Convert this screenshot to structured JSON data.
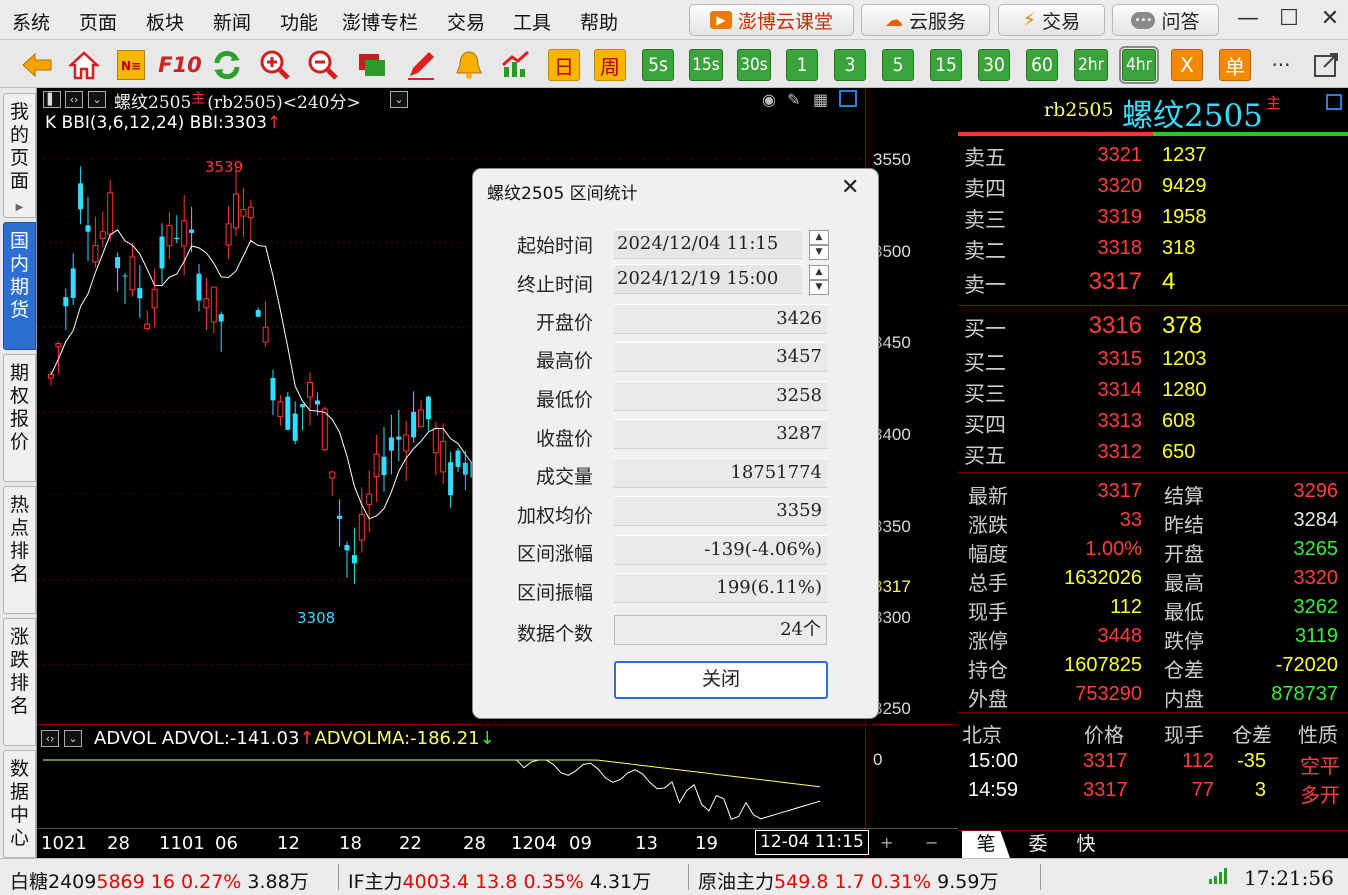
{
  "menu": [
    "系统",
    "页面",
    "板块",
    "新闻",
    "功能",
    "澎博专栏",
    "交易",
    "工具",
    "帮助"
  ],
  "top_buttons": [
    "澎博云课堂",
    "云服务",
    "交易",
    "问答"
  ],
  "toolbar": {
    "icons": [
      "back-arrow-icon",
      "home-icon",
      "news-icon",
      "f10-icon",
      "refresh-icon",
      "zoom-in-icon",
      "zoom-out-icon",
      "layers-icon",
      "pen-icon",
      "bell-icon",
      "trend-icon"
    ],
    "f10": "F10",
    "periods": [
      "日",
      "周",
      "5s",
      "15s",
      "30s",
      "1",
      "3",
      "5",
      "15",
      "30",
      "60",
      "2hr",
      "4hr"
    ],
    "selected_period": "4hr",
    "x_label": "X",
    "order_label": "单",
    "more": "···"
  },
  "sidebar": [
    {
      "label": "我的页面",
      "active": false
    },
    {
      "label": "国内期货",
      "active": true
    },
    {
      "label": "期权报价",
      "active": false
    },
    {
      "label": "热点排名",
      "active": false
    },
    {
      "label": "涨跌排名",
      "active": false
    },
    {
      "label": "数据中心",
      "active": false
    }
  ],
  "chart": {
    "title": "螺纹2505",
    "title_tag": "主",
    "code_period": "(rb2505)<240分>",
    "indicator_line": "K BBI(3,6,12,24) BBI:3303",
    "up_arrow": "↑",
    "high_label": "3539",
    "low_label": "3308",
    "last_price_label": "3317",
    "sub_indicator_name": "ADVOL",
    "sub_indicator_val": "ADVOL:-141.03",
    "sub_indicator_ma": "ADVOLMA:-186.21",
    "sub_arrow_up": "↑",
    "sub_arrow_down": "↓",
    "sub_zero_label": "0",
    "date_axis": [
      "1021",
      "28",
      "1101",
      "06",
      "12",
      "18",
      "22",
      "28",
      "1204",
      "09",
      "13",
      "19"
    ],
    "cursor_time": "12-04 11:15",
    "zoom_plus": "+",
    "zoom_minus": "−",
    "colors": {
      "up": "#ff3333",
      "down": "#33ddff",
      "bbi": "#ffffff",
      "advolma": "#ffff66"
    }
  },
  "chart_data": {
    "type": "candlestick",
    "price_axis": [
      "3550",
      "3500",
      "3450",
      "3400",
      "3350",
      "3300",
      "3250"
    ],
    "ylim": [
      3245,
      3565
    ],
    "note_ticks": [
      3550,
      3500,
      3450,
      3400,
      3350,
      3300,
      3250
    ],
    "visible_range_high": 3539,
    "visible_range_low": 3308,
    "last": 3317
  },
  "dialog": {
    "title": "螺纹2505 区间统计",
    "fields": [
      {
        "label": "起始时间",
        "value": "2024/12/04  11:15"
      },
      {
        "label": "终止时间",
        "value": "2024/12/19  15:00"
      },
      {
        "label": "开盘价",
        "value": "3426"
      },
      {
        "label": "最高价",
        "value": "3457"
      },
      {
        "label": "最低价",
        "value": "3258"
      },
      {
        "label": "收盘价",
        "value": "3287"
      },
      {
        "label": "成交量",
        "value": "18751774"
      },
      {
        "label": "加权均价",
        "value": "3359"
      },
      {
        "label": "区间涨幅",
        "value": "-139(-4.06%)"
      },
      {
        "label": "区间振幅",
        "value": "199(6.11%)"
      },
      {
        "label": "数据个数",
        "value": "24个"
      }
    ],
    "close_button": "关闭"
  },
  "quote": {
    "code": "rb2505",
    "name": "螺纹2505",
    "tag": "主",
    "asks": [
      {
        "label": "卖五",
        "price": "3321",
        "vol": "1237"
      },
      {
        "label": "卖四",
        "price": "3320",
        "vol": "9429"
      },
      {
        "label": "卖三",
        "price": "3319",
        "vol": "1958"
      },
      {
        "label": "卖二",
        "price": "3318",
        "vol": "318"
      },
      {
        "label": "卖一",
        "price": "3317",
        "vol": "4"
      }
    ],
    "bids": [
      {
        "label": "买一",
        "price": "3316",
        "vol": "378"
      },
      {
        "label": "买二",
        "price": "3315",
        "vol": "1203"
      },
      {
        "label": "买三",
        "price": "3314",
        "vol": "1280"
      },
      {
        "label": "买四",
        "price": "3313",
        "vol": "608"
      },
      {
        "label": "买五",
        "price": "3312",
        "vol": "650"
      }
    ],
    "stats_left": [
      {
        "label": "最新",
        "value": "3317",
        "color": "#ff3d3d"
      },
      {
        "label": "涨跌",
        "value": "33",
        "color": "#ff3d3d"
      },
      {
        "label": "幅度",
        "value": "1.00%",
        "color": "#ff3d3d"
      },
      {
        "label": "总手",
        "value": "1632026",
        "color": "#ffff2a"
      },
      {
        "label": "现手",
        "value": "112",
        "color": "#ffff2a"
      },
      {
        "label": "涨停",
        "value": "3448",
        "color": "#ff3d3d"
      },
      {
        "label": "持仓",
        "value": "1607825",
        "color": "#ffff2a"
      },
      {
        "label": "外盘",
        "value": "753290",
        "color": "#ff3d3d"
      }
    ],
    "stats_right": [
      {
        "label": "结算",
        "value": "3296",
        "color": "#ff3d3d"
      },
      {
        "label": "昨结",
        "value": "3284",
        "color": "#e8e8e8"
      },
      {
        "label": "开盘",
        "value": "3265",
        "color": "#33ee33"
      },
      {
        "label": "最高",
        "value": "3320",
        "color": "#ff3d3d"
      },
      {
        "label": "最低",
        "value": "3262",
        "color": "#33ee33"
      },
      {
        "label": "跌停",
        "value": "3119",
        "color": "#33ee33"
      },
      {
        "label": "仓差",
        "value": "-72020",
        "color": "#ffff2a"
      },
      {
        "label": "内盘",
        "value": "878737",
        "color": "#33ee33"
      }
    ],
    "ticks_header": [
      "北京",
      "价格",
      "现手",
      "仓差",
      "性质"
    ],
    "ticks": [
      {
        "time": "15:00",
        "price": "3317",
        "vol": "112",
        "oi": "-35",
        "nature": "空平"
      },
      {
        "time": "14:59",
        "price": "3317",
        "vol": "77",
        "oi": "3",
        "nature": "多开"
      }
    ],
    "bottom_tabs": [
      "笔",
      "委",
      "快"
    ]
  },
  "statusbar": {
    "items": [
      {
        "name": "白糖2409",
        "price": "5869",
        "chg": "16",
        "pct": "0.27%",
        "vol": "3.88万"
      },
      {
        "name": "IF主力",
        "price": "4003.4",
        "chg": "13.8",
        "pct": "0.35%",
        "vol": "4.31万"
      },
      {
        "name": "原油主力",
        "price": "549.8",
        "chg": "1.7",
        "pct": "0.31%",
        "vol": "9.59万"
      }
    ],
    "time": "17:21:56"
  }
}
